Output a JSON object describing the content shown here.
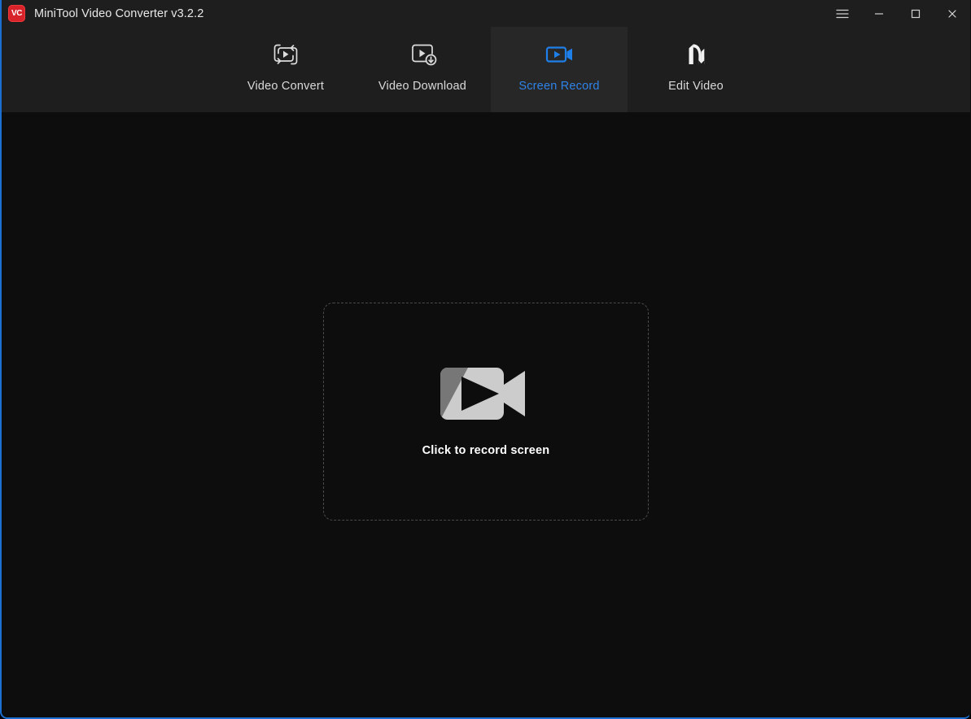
{
  "window": {
    "title": "MiniTool Video Converter v3.2.2",
    "logo_text": "VC",
    "logo_color": "#d8232a",
    "accent_color": "#2f83e8",
    "titlebar_bg": "#1e1e1e",
    "body_bg": "#0d0d0d",
    "focus_border_color": "#1b6fd0"
  },
  "window_controls": [
    {
      "name": "menu",
      "icon": "hamburger-menu-icon",
      "label": "Menu"
    },
    {
      "name": "minimize",
      "icon": "minimize-icon",
      "label": "Minimize"
    },
    {
      "name": "maximize",
      "icon": "maximize-icon",
      "label": "Maximize"
    },
    {
      "name": "close",
      "icon": "close-icon",
      "label": "Close"
    }
  ],
  "nav": {
    "tabs": [
      {
        "label": "Video Convert",
        "icon": "video-convert-icon",
        "active": false
      },
      {
        "label": "Video Download",
        "icon": "video-download-icon",
        "active": false
      },
      {
        "label": "Screen Record",
        "icon": "screen-record-icon",
        "active": true
      },
      {
        "label": "Edit Video",
        "icon": "edit-video-m-logo-icon",
        "active": false
      }
    ],
    "active_tab": "Screen Record"
  },
  "main": {
    "dropzone": {
      "label": "Click to record screen",
      "icon": "camcorder-icon",
      "icon_color_light": "#cccccc",
      "icon_color_dark": "#777777",
      "border_style": "dashed",
      "border_color": "#4a4a4a"
    }
  }
}
